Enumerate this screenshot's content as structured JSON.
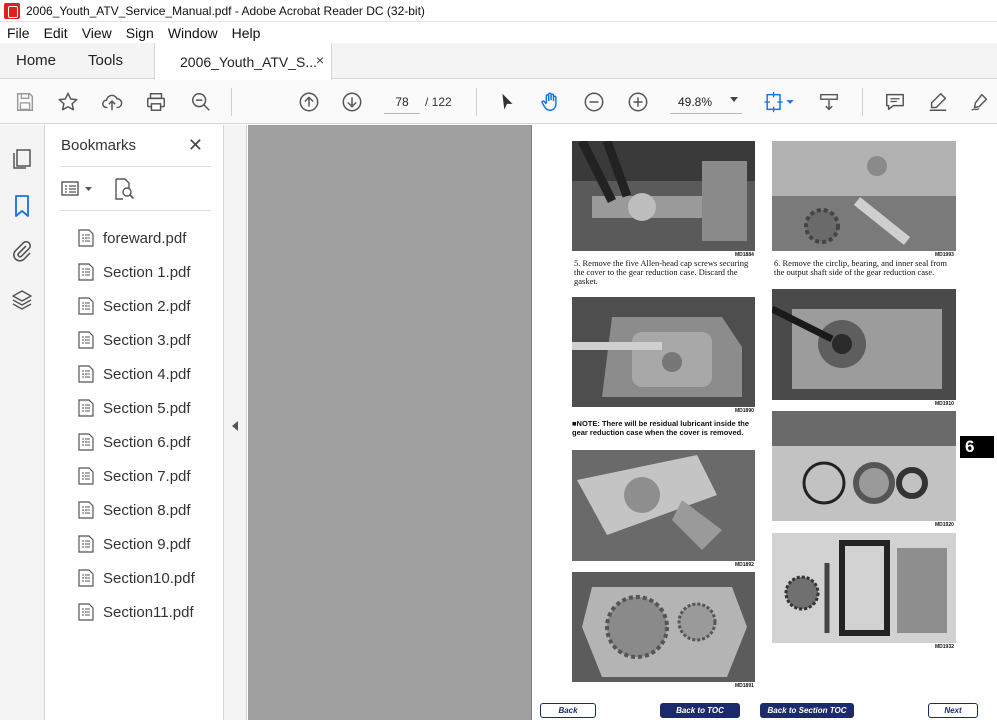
{
  "window": {
    "title": "2006_Youth_ATV_Service_Manual.pdf - Adobe Acrobat Reader DC (32-bit)"
  },
  "menu": {
    "items": [
      "File",
      "Edit",
      "View",
      "Sign",
      "Window",
      "Help"
    ]
  },
  "tabs": {
    "home": "Home",
    "tools": "Tools",
    "document": "2006_Youth_ATV_S...",
    "close_symbol": "×"
  },
  "toolbar": {
    "page_current": "78",
    "page_total": "/ 122",
    "zoom": "49.8%",
    "icons": [
      "save-icon",
      "bookmark-star-icon",
      "upload-icon",
      "print-icon",
      "zoom-search-icon",
      "page-up-icon",
      "page-down-icon",
      "select-cursor-icon",
      "hand-icon",
      "zoom-out-icon",
      "zoom-in-icon",
      "fit-page-icon",
      "scroll-mode-icon",
      "comment-icon",
      "highlight-icon",
      "sign-icon"
    ]
  },
  "bookmarks": {
    "title": "Bookmarks",
    "close_symbol": "✕",
    "items": [
      {
        "label": "foreward.pdf"
      },
      {
        "label": "Section 1.pdf"
      },
      {
        "label": "Section 2.pdf"
      },
      {
        "label": "Section 3.pdf"
      },
      {
        "label": "Section 4.pdf"
      },
      {
        "label": "Section 5.pdf"
      },
      {
        "label": "Section 6.pdf"
      },
      {
        "label": "Section 7.pdf"
      },
      {
        "label": "Section 8.pdf"
      },
      {
        "label": "Section 9.pdf"
      },
      {
        "label": "Section10.pdf"
      },
      {
        "label": "Section11.pdf"
      }
    ]
  },
  "page": {
    "section_tab": "6",
    "photos": {
      "p1": "MD1884",
      "p2": "MD1890",
      "p3": "MD1892",
      "p4": "MD1891",
      "p5": "MD1993",
      "p6": "MD1910",
      "p7": "MD1920",
      "p8": "MD1932"
    },
    "caption_left": "5. Remove the five Allen-head cap screws securing the cover to the gear reduction case. Discard the gasket.",
    "note": "■NOTE: There will be residual lubricant inside the gear reduction case when the cover is removed.",
    "caption_right": "6. Remove the circlip, bearing, and inner seal from the output shaft side of the gear reduction case.",
    "nav": {
      "back": "Back",
      "back_to_toc": "Back to TOC",
      "back_to_section_toc": "Back to Section TOC",
      "next": "Next"
    }
  },
  "colors": {
    "acrobat_red": "#e02020",
    "nav_blue": "#1b2a6b",
    "doc_background": "#a0a0a0"
  }
}
